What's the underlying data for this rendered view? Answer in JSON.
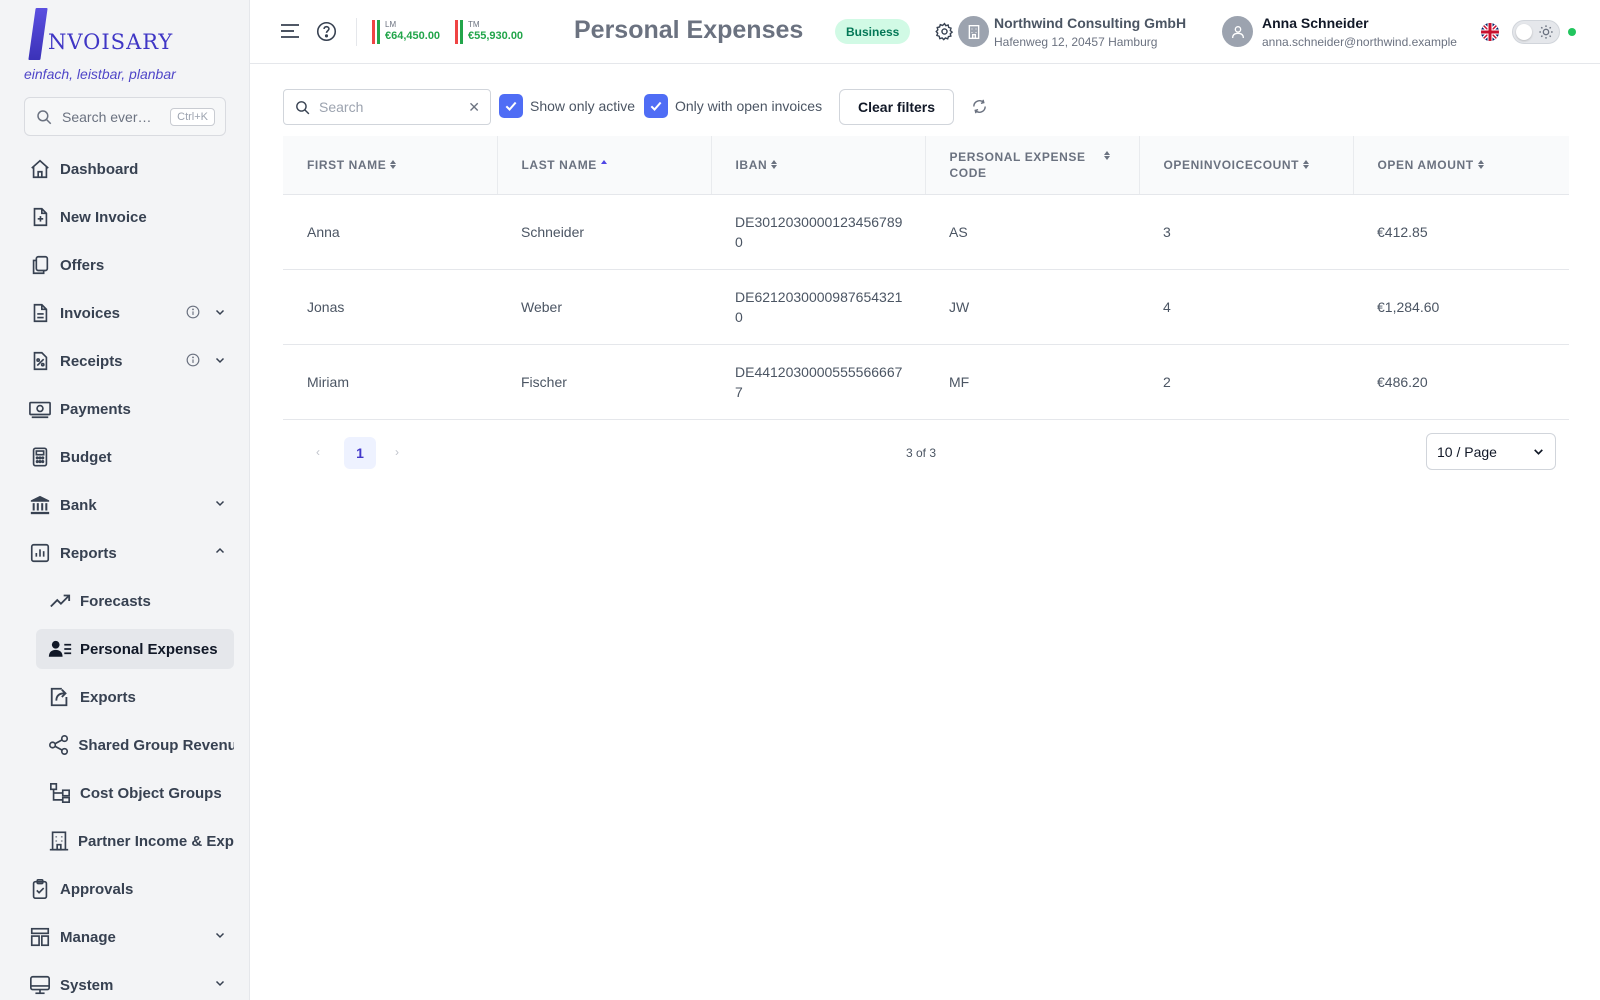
{
  "brand": {
    "logo_text": "NVOISARY",
    "slogan": "einfach, leistbar, planbar"
  },
  "sidebar": {
    "search_placeholder": "Search ever…",
    "search_shortcut": "Ctrl+K",
    "items": [
      {
        "label": "Dashboard",
        "icon": "home-icon"
      },
      {
        "label": "New Invoice",
        "icon": "file-plus-icon"
      },
      {
        "label": "Offers",
        "icon": "copy-icon"
      },
      {
        "label": "Invoices",
        "icon": "file-icon"
      },
      {
        "label": "Receipts",
        "icon": "receipt-percent-icon"
      },
      {
        "label": "Payments",
        "icon": "banknote-icon"
      },
      {
        "label": "Budget",
        "icon": "calculator-icon"
      },
      {
        "label": "Bank",
        "icon": "bank-icon"
      },
      {
        "label": "Reports",
        "icon": "bar-chart-icon"
      }
    ],
    "report_subitems": [
      {
        "label": "Forecasts",
        "icon": "trend-up-icon"
      },
      {
        "label": "Personal Expenses",
        "icon": "user-list-icon"
      },
      {
        "label": "Exports",
        "icon": "export-icon"
      },
      {
        "label": "Shared Group Revenue",
        "icon": "share-icon"
      },
      {
        "label": "Cost Object Groups",
        "icon": "hierarchy-icon"
      },
      {
        "label": "Partner Income & Expenses",
        "icon": "building-icon"
      }
    ],
    "bottom_items": [
      {
        "label": "Approvals",
        "icon": "clipboard-check-icon"
      },
      {
        "label": "Manage",
        "icon": "layout-icon"
      },
      {
        "label": "System",
        "icon": "monitor-icon"
      }
    ]
  },
  "header": {
    "kpi_last_month": {
      "label": "LM",
      "value": "€64,450.00"
    },
    "kpi_this_month": {
      "label": "TM",
      "value": "€55,930.00"
    },
    "page_title": "Personal Expenses",
    "badge": "Business",
    "company": {
      "name": "Northwind Consulting GmbH",
      "address": "Hafenweg 12, 20457 Hamburg"
    },
    "user": {
      "name": "Anna Schneider",
      "email": "anna.schneider@northwind.example"
    }
  },
  "filters": {
    "search_placeholder": "Search",
    "search_value": "",
    "show_only_active": "Show only active",
    "only_open_invoices": "Only with open invoices",
    "clear_filters": "Clear filters"
  },
  "table": {
    "columns": [
      "First Name",
      "Last Name",
      "IBAN",
      "Personal Expense Code",
      "OpenInvoiceCount",
      "Open Amount"
    ],
    "rows": [
      [
        "Anna",
        "Schneider",
        "DE30120300001234567890",
        "AS",
        "3",
        "€412.85"
      ],
      [
        "Jonas",
        "Weber",
        "DE62120300009876543210",
        "JW",
        "4",
        "€1,284.60"
      ],
      [
        "Miriam",
        "Fischer",
        "DE44120300005555666677",
        "MF",
        "2",
        "€486.20"
      ]
    ]
  },
  "pagination": {
    "prev": "‹",
    "next": "›",
    "current_page": "1",
    "count_text": "3 of 3",
    "page_size": "10 / Page"
  },
  "colors": {
    "accent": "#4f46e5",
    "checkbox": "#4f6df5",
    "kpi_green": "#22a54a",
    "badge_bg": "#d1fae5",
    "badge_text": "#047857"
  }
}
